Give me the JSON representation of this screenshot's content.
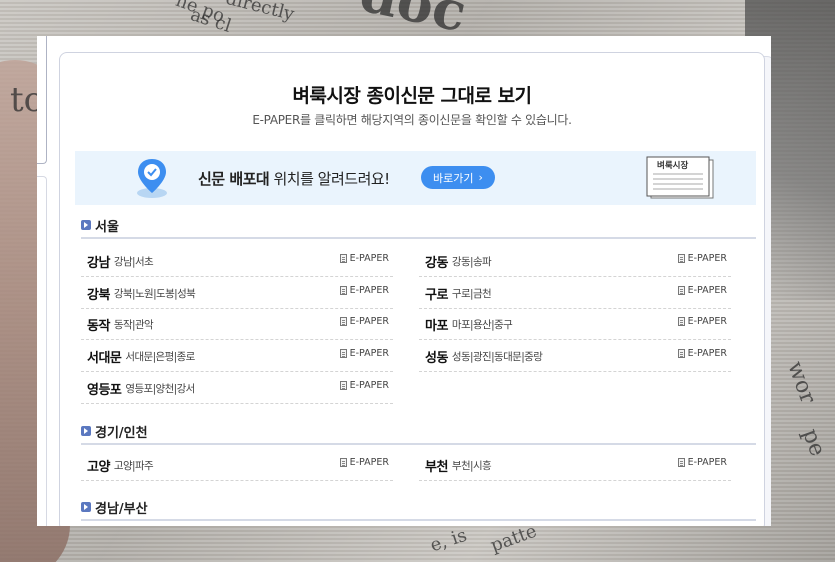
{
  "header": {
    "title": "벼룩시장 종이신문 그대로 보기",
    "subtitle": "E-PAPER를 클릭하면 해당지역의 종이신문을 확인할 수 있습니다."
  },
  "banner": {
    "text_bold": "신문 배포대",
    "text_rest": " 위치를 알려드려요!",
    "button_label": "바로가기",
    "paper_label": "벼룩시장"
  },
  "background_words": [
    "ne po",
    "as cl",
    "directly",
    "doc",
    "to",
    "wor",
    "pe",
    "e, is",
    "patte"
  ],
  "sections": [
    {
      "title": "서울",
      "rows": [
        {
          "region": "강남",
          "subs": "강남|서초",
          "link": "E-PAPER"
        },
        {
          "region": "강동",
          "subs": "강동|송파",
          "link": "E-PAPER"
        },
        {
          "region": "강북",
          "subs": "강북|노원|도봉|성북",
          "link": "E-PAPER"
        },
        {
          "region": "구로",
          "subs": "구로|금천",
          "link": "E-PAPER"
        },
        {
          "region": "동작",
          "subs": "동작|관악",
          "link": "E-PAPER"
        },
        {
          "region": "마포",
          "subs": "마포|용산|중구",
          "link": "E-PAPER"
        },
        {
          "region": "서대문",
          "subs": "서대문|은평|종로",
          "link": "E-PAPER"
        },
        {
          "region": "성동",
          "subs": "성동|광진|동대문|중랑",
          "link": "E-PAPER"
        },
        {
          "region": "영등포",
          "subs": "영등포|양천|강서",
          "link": "E-PAPER"
        }
      ]
    },
    {
      "title": "경기/인천",
      "rows": [
        {
          "region": "고양",
          "subs": "고양|파주",
          "link": "E-PAPER"
        },
        {
          "region": "부천",
          "subs": "부천|시흥",
          "link": "E-PAPER"
        }
      ]
    },
    {
      "title": "경남/부산",
      "rows": []
    }
  ]
}
